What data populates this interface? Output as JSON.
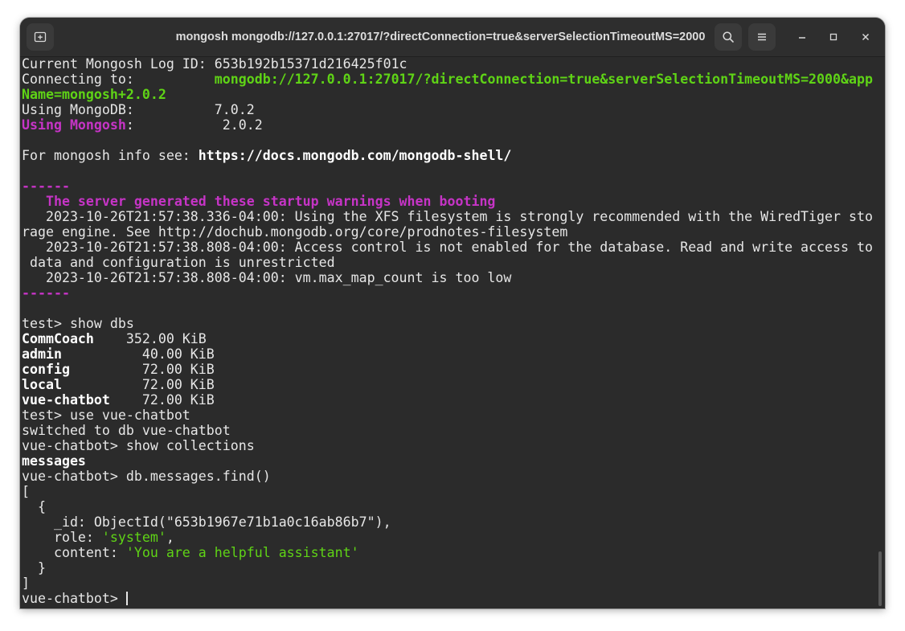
{
  "window": {
    "title": "mongosh mongodb://127.0.0.1:27017/?directConnection=true&serverSelectionTimeoutMS=2000"
  },
  "icons": {
    "new_tab": "new-tab-icon",
    "search": "search-icon",
    "menu": "hamburger-menu-icon",
    "minimize": "minimize-icon",
    "maximize": "maximize-icon",
    "close": "close-icon"
  },
  "colors": {
    "background": "#2b2b2b",
    "text": "#e6e6e6",
    "green": "#5fd316",
    "magenta": "#c634c6"
  },
  "terminal": {
    "log_id_label": "Current Mongosh Log ID:",
    "log_id_value": "653b192b15371d216425f01c",
    "connecting_label": "Connecting to:",
    "connecting_url_1": "mongodb://127.0.0.1:27017/?directConnection=true&serverSelectionTimeoutMS=2000&app",
    "connecting_url_2": "Name=mongosh+2.0.2",
    "mongodb_label": "Using MongoDB:",
    "mongodb_version": "7.0.2",
    "mongosh_label": "Using Mongosh",
    "mongosh_colon": ":",
    "mongosh_version": "2.0.2",
    "info_text": "For mongosh info see: ",
    "info_url": "https://docs.mongodb.com/mongodb-shell/",
    "separator": "------",
    "warning_title": "   The server generated these startup warnings when booting",
    "warning_1a": "   2023-10-26T21:57:38.336-04:00: Using the XFS filesystem is strongly recommended with the WiredTiger sto",
    "warning_1b": "rage engine. See http://dochub.mongodb.org/core/prodnotes-filesystem",
    "warning_2a": "   2023-10-26T21:57:38.808-04:00: Access control is not enabled for the database. Read and write access to",
    "warning_2b": " data and configuration is unrestricted",
    "warning_3": "   2023-10-26T21:57:38.808-04:00: vm.max_map_count is too low",
    "cmd_show_dbs": "test> show dbs",
    "databases": [
      {
        "name": "CommCoach",
        "size": "    352.00 KiB"
      },
      {
        "name": "admin",
        "size": "          40.00 KiB"
      },
      {
        "name": "config",
        "size": "         72.00 KiB"
      },
      {
        "name": "local",
        "size": "          72.00 KiB"
      },
      {
        "name": "vue-chatbot",
        "size": "    72.00 KiB"
      }
    ],
    "cmd_use": "test> use vue-chatbot",
    "switched": "switched to db vue-chatbot",
    "cmd_show_collections": "vue-chatbot> show collections",
    "collection": "messages",
    "cmd_find": "vue-chatbot> db.messages.find()",
    "out_open_bracket": "[",
    "out_open_brace": "  {",
    "out_id": "    _id: ObjectId(\"653b1967e71b1a0c16ab86b7\"),",
    "out_role_key": "    role: ",
    "out_role_value": "'system'",
    "out_role_comma": ",",
    "out_content_key": "    content: ",
    "out_content_value": "'You are a helpful assistant'",
    "out_close_brace": "  }",
    "out_close_bracket": "]",
    "prompt": "vue-chatbot> "
  }
}
